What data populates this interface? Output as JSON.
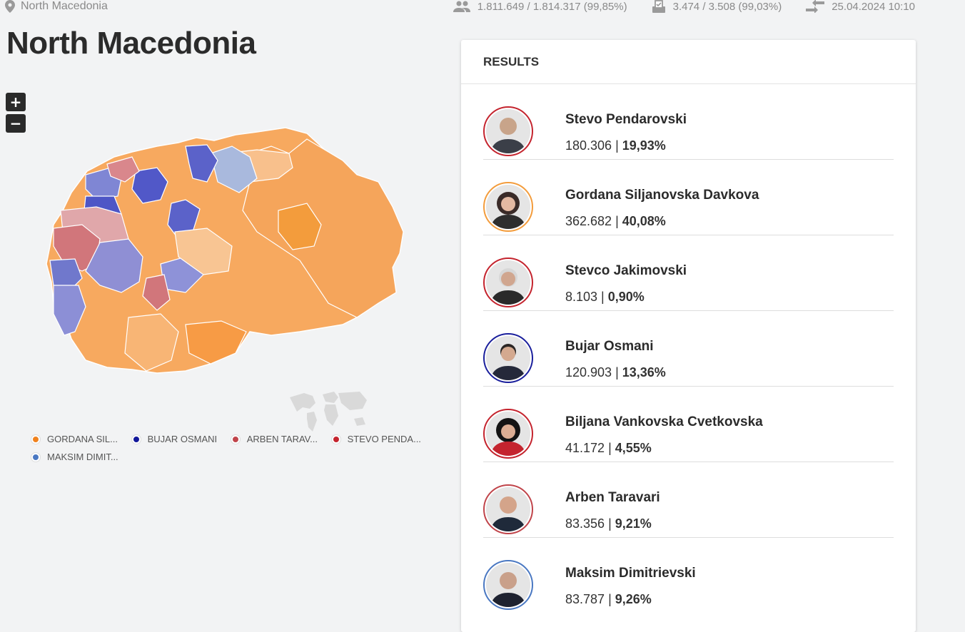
{
  "header": {
    "location": "North Macedonia",
    "voters": "1.811.649 / 1.814.317 (99,85%)",
    "stations": "3.474 / 3.508 (99,03%)",
    "updated": "25.04.2024 10:10"
  },
  "title": "North Macedonia",
  "map": {
    "zoom_in": "+",
    "zoom_out": "−"
  },
  "legend": [
    {
      "label": "GORDANA SIL...",
      "color": "#f39c3c"
    },
    {
      "label": "BUJAR OSMANI",
      "color": "#1a1f9c"
    },
    {
      "label": "ARBEN TARAV...",
      "color": "#c0444a"
    },
    {
      "label": "STEVO PENDA...",
      "color": "#c4242e"
    },
    {
      "label": "MAKSIM DIMIT...",
      "color": "#4a78c2"
    }
  ],
  "results": {
    "heading": "RESULTS",
    "candidates": [
      {
        "name": "Stevo Pendarovski",
        "votes": "180.306",
        "pct": "19,93%",
        "ring": "#c4242e"
      },
      {
        "name": "Gordana Siljanovska Davkova",
        "votes": "362.682",
        "pct": "40,08%",
        "ring": "#f39c3c"
      },
      {
        "name": "Stevco Jakimovski",
        "votes": "8.103",
        "pct": "0,90%",
        "ring": "#c4242e"
      },
      {
        "name": "Bujar Osmani",
        "votes": "120.903",
        "pct": "13,36%",
        "ring": "#1a1f9c"
      },
      {
        "name": "Biljana Vankovska Cvetkovska",
        "votes": "41.172",
        "pct": "4,55%",
        "ring": "#c4242e"
      },
      {
        "name": "Arben Taravari",
        "votes": "83.356",
        "pct": "9,21%",
        "ring": "#c0444a"
      },
      {
        "name": "Maksim Dimitrievski",
        "votes": "83.787",
        "pct": "9,26%",
        "ring": "#4a78c2"
      }
    ]
  }
}
